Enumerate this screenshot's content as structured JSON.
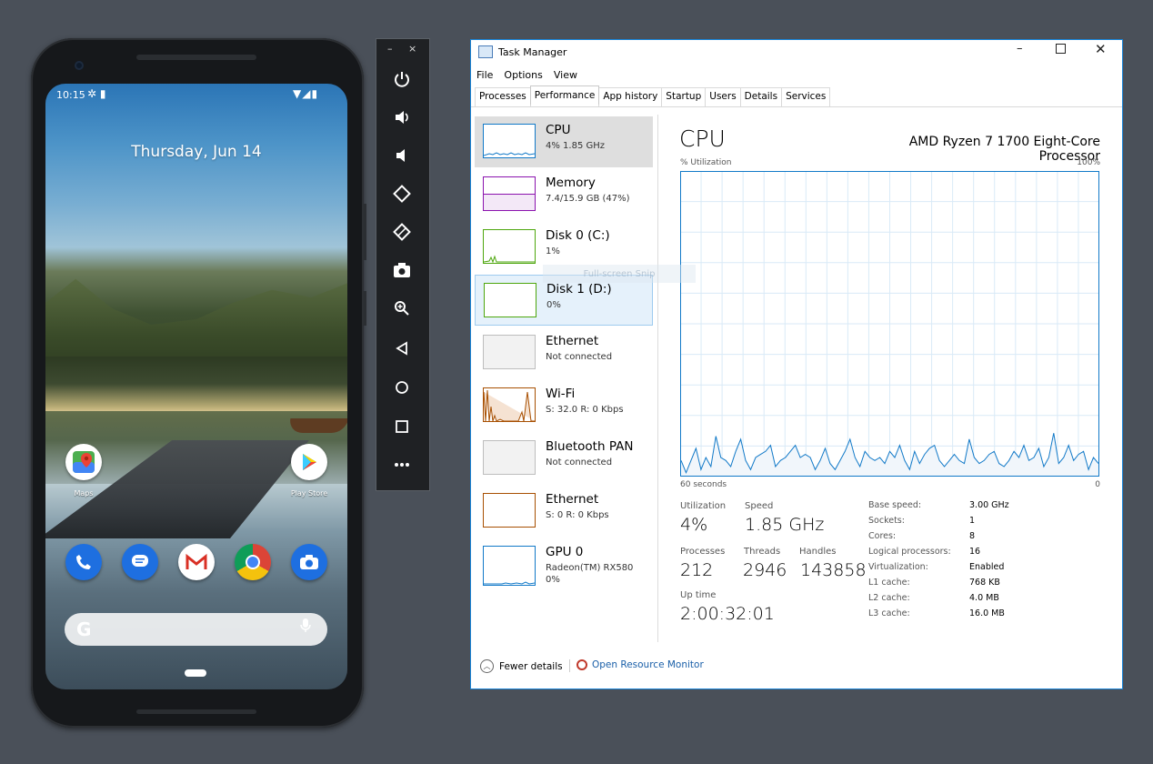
{
  "phone": {
    "status_time": "10:15",
    "status_left_icons": "✲ ▮",
    "status_right_icons": "▼◢▮",
    "date": "Thursday, Jun 14",
    "apps": {
      "maps_label": "Maps",
      "play_label": "Play Store"
    },
    "dock_icons": [
      "phone-icon",
      "messages-icon",
      "gmail-icon",
      "chrome-icon",
      "camera-icon"
    ],
    "search_logo": "G"
  },
  "emulator_toolbar": {
    "minimize": "–",
    "close": "×",
    "buttons": [
      "power",
      "volume-up",
      "volume-down",
      "rotate-left",
      "rotate-right",
      "screenshot",
      "zoom",
      "back",
      "home",
      "overview",
      "more"
    ]
  },
  "task_manager": {
    "title": "Task Manager",
    "menu": [
      "File",
      "Options",
      "View"
    ],
    "tabs": [
      "Processes",
      "Performance",
      "App history",
      "Startup",
      "Users",
      "Details",
      "Services"
    ],
    "active_tab": "Performance",
    "sidebar": [
      {
        "name": "CPU",
        "sub": "4% 1.85 GHz",
        "color": "#1179c8",
        "selected": true
      },
      {
        "name": "Memory",
        "sub": "7.4/15.9 GB (47%)",
        "color": "#8b12ae"
      },
      {
        "name": "Disk 0 (C:)",
        "sub": "1%",
        "color": "#4da60c"
      },
      {
        "name": "Disk 1 (D:)",
        "sub": "0%",
        "color": "#4da60c",
        "hovered": true
      },
      {
        "name": "Ethernet",
        "sub": "Not connected",
        "color": "#a7a7a7"
      },
      {
        "name": "Wi-Fi",
        "sub": "S: 32.0  R: 0 Kbps",
        "color": "#a74f01"
      },
      {
        "name": "Bluetooth PAN",
        "sub": "Not connected",
        "color": "#a7a7a7"
      },
      {
        "name": "Ethernet",
        "sub": "S: 0  R: 0 Kbps",
        "color": "#a74f01"
      },
      {
        "name": "GPU 0",
        "sub": "Radeon(TM) RX580",
        "sub2": "0%",
        "color": "#1179c8"
      }
    ],
    "main": {
      "title": "CPU",
      "model": "AMD Ryzen 7 1700 Eight-Core Processor",
      "util_label": "% Utilization",
      "util_max": "100%",
      "time_label": "60 seconds",
      "zero_label": "0",
      "stats": {
        "utilization_label": "Utilization",
        "utilization": "4%",
        "speed_label": "Speed",
        "speed": "1.85 GHz",
        "processes_label": "Processes",
        "processes": "212",
        "threads_label": "Threads",
        "threads": "2946",
        "handles_label": "Handles",
        "handles": "143858",
        "uptime_label": "Up time",
        "uptime": "2:00:32:01"
      },
      "specs": [
        {
          "label": "Base speed:",
          "value": "3.00 GHz"
        },
        {
          "label": "Sockets:",
          "value": "1"
        },
        {
          "label": "Cores:",
          "value": "8"
        },
        {
          "label": "Logical processors:",
          "value": "16"
        },
        {
          "label": "Virtualization:",
          "value": "Enabled"
        },
        {
          "label": "L1 cache:",
          "value": "768 KB"
        },
        {
          "label": "L2 cache:",
          "value": "4.0 MB"
        },
        {
          "label": "L3 cache:",
          "value": "16.0 MB"
        }
      ],
      "cpu_history": [
        5,
        1,
        5,
        9,
        2,
        6,
        3,
        13,
        6,
        5,
        3,
        8,
        12,
        5,
        2,
        6,
        7,
        8,
        10,
        3,
        5,
        6,
        8,
        10,
        6,
        7,
        6,
        2,
        5,
        9,
        4,
        2,
        5,
        8,
        12,
        6,
        3,
        8,
        6,
        5,
        6,
        4,
        8,
        6,
        10,
        5,
        2,
        8,
        4,
        7,
        9,
        10,
        5,
        3,
        5,
        7,
        5,
        4,
        12,
        6,
        4,
        5,
        7,
        8,
        4,
        3,
        5,
        8,
        6,
        10,
        5,
        6,
        9,
        3,
        6,
        14,
        4,
        6,
        10,
        5,
        7,
        8,
        2,
        6,
        4
      ]
    },
    "fewer_details": "Fewer details",
    "resource_monitor": "Open Resource Monitor",
    "snip_overlay": "Full-screen Snip"
  }
}
